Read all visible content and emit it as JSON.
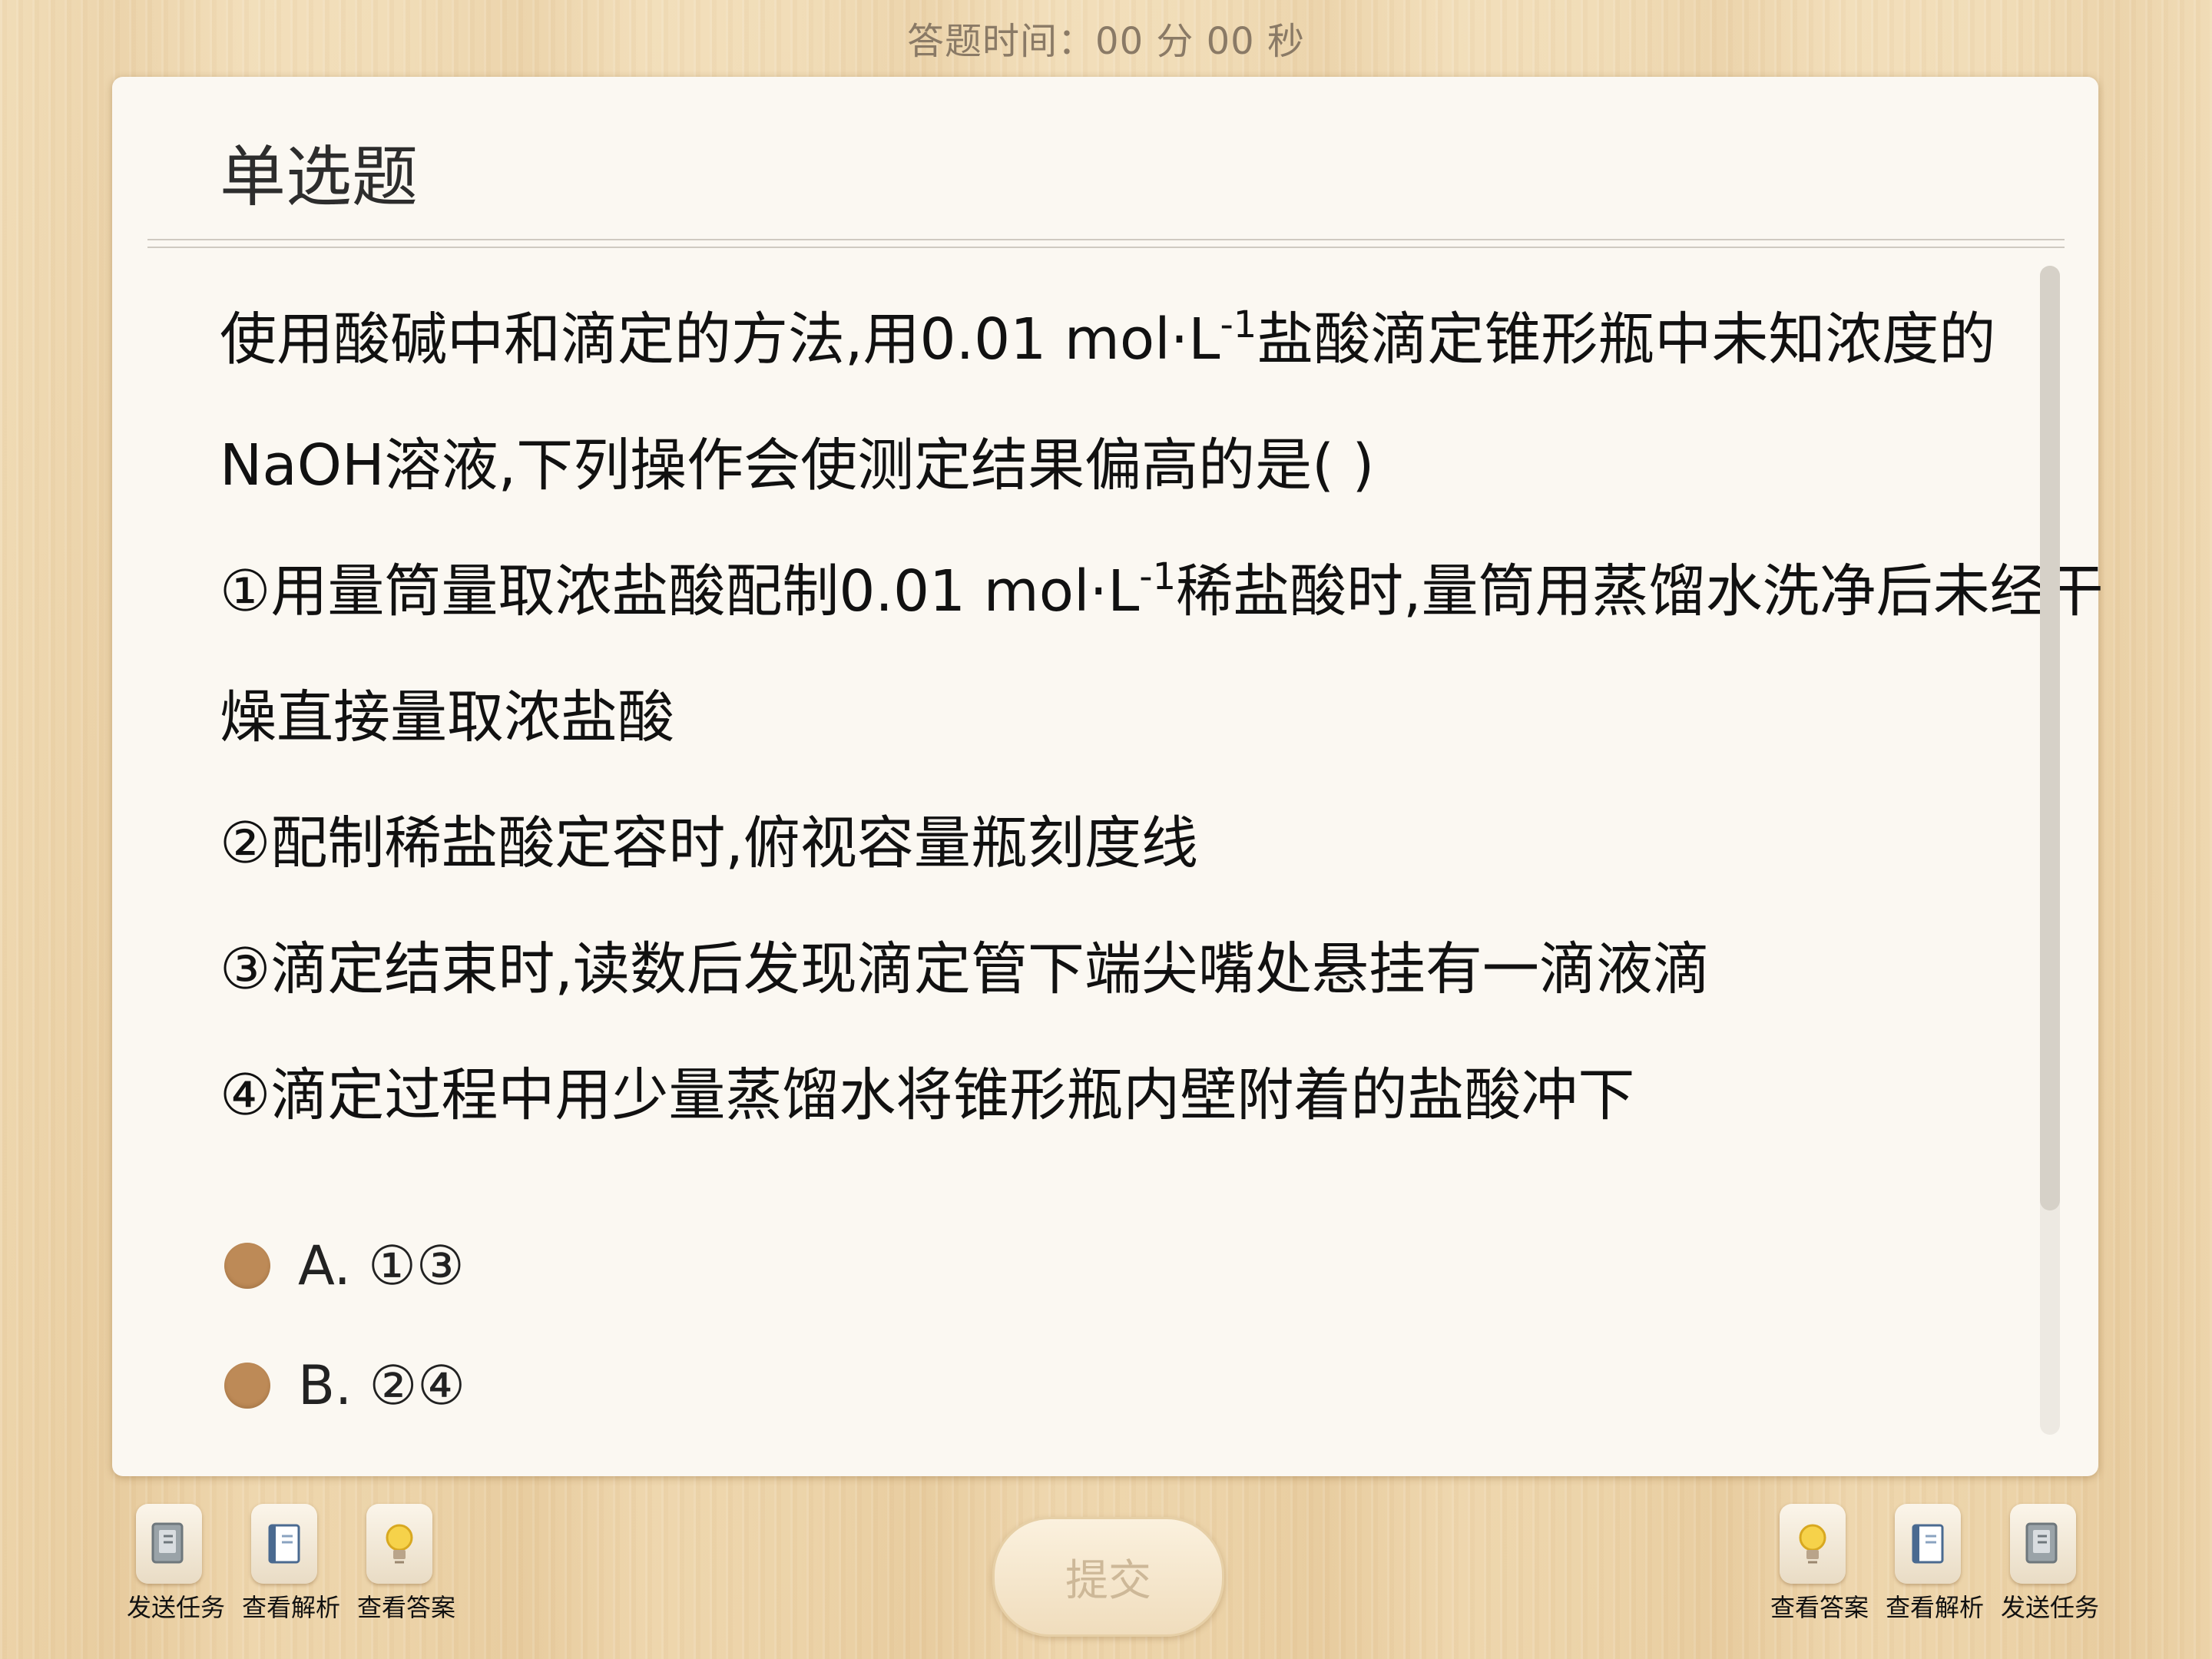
{
  "timer": {
    "text": "答题时间：00 分 00 秒"
  },
  "question": {
    "type_label": "单选题",
    "lines": [
      {
        "parts": [
          "使用酸碱中和滴定的方法,用0.01   mol·L",
          "-1",
          "盐酸滴定锥形瓶中未知浓度的"
        ]
      },
      {
        "text": "NaOH溶液,下列操作会使测定结果偏高的是(       )"
      },
      {
        "parts": [
          "①用量筒量取浓盐酸配制0.01   mol·L",
          "-1",
          "稀盐酸时,量筒用蒸馏水洗净后未经干"
        ]
      },
      {
        "text": "燥直接量取浓盐酸"
      },
      {
        "text": "②配制稀盐酸定容时,俯视容量瓶刻度线"
      },
      {
        "text": "③滴定结束时,读数后发现滴定管下端尖嘴处悬挂有一滴液滴"
      },
      {
        "text": "④滴定过程中用少量蒸馏水将锥形瓶内壁附着的盐酸冲下"
      }
    ],
    "options": [
      {
        "label": "A. ①③"
      },
      {
        "label": "B. ②④"
      }
    ]
  },
  "toolbar_left": [
    {
      "label": "发送任务",
      "icon": "send-task-icon"
    },
    {
      "label": "查看解析",
      "icon": "analysis-book-icon"
    },
    {
      "label": "查看答案",
      "icon": "lightbulb-icon"
    }
  ],
  "toolbar_right": [
    {
      "label": "查看答案",
      "icon": "lightbulb-icon"
    },
    {
      "label": "查看解析",
      "icon": "analysis-book-icon"
    },
    {
      "label": "发送任务",
      "icon": "send-task-icon"
    }
  ],
  "submit": {
    "label": "提交"
  },
  "colors": {
    "option_dot": "#bd8a57",
    "background": "#edd7b0",
    "card": "#fbf8f2"
  }
}
